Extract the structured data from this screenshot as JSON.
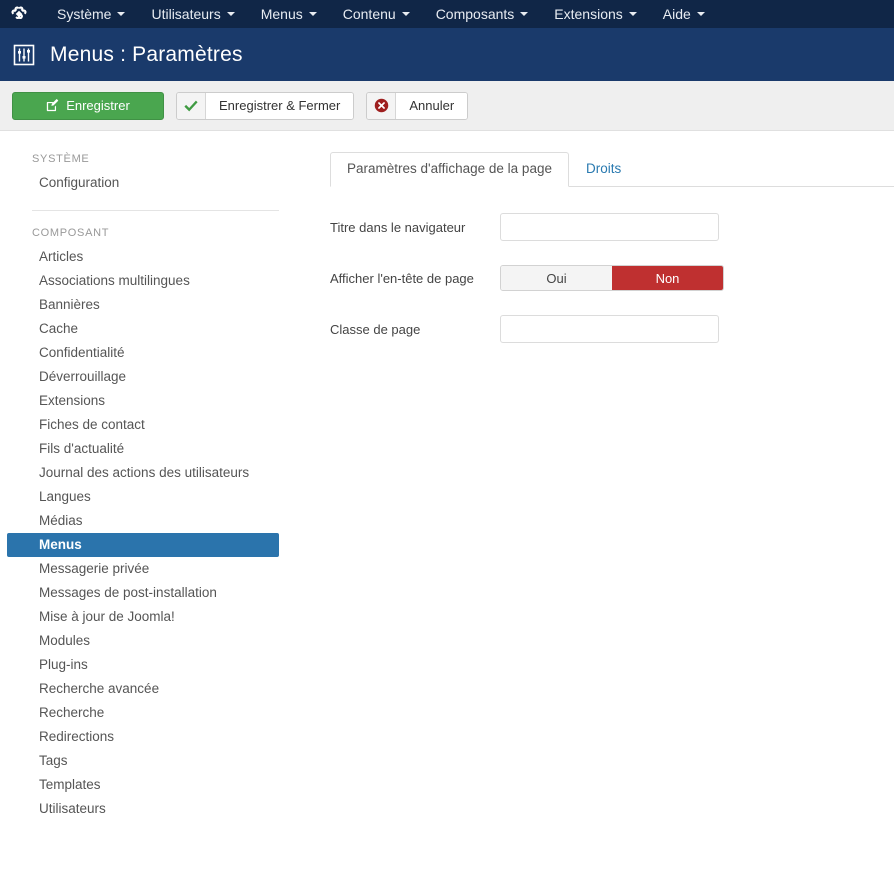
{
  "topbar": {
    "logo_icon": "joomla-logo-icon",
    "menu": [
      {
        "label": "Système",
        "caret": true
      },
      {
        "label": "Utilisateurs",
        "caret": true
      },
      {
        "label": "Menus",
        "caret": true
      },
      {
        "label": "Contenu",
        "caret": true
      },
      {
        "label": "Composants",
        "caret": true
      },
      {
        "label": "Extensions",
        "caret": true
      },
      {
        "label": "Aide",
        "caret": true
      }
    ]
  },
  "pageheader": {
    "icon": "menus-sliders-icon",
    "title": "Menus : Paramètres"
  },
  "toolbar": {
    "save_label": "Enregistrer",
    "save_icon": "edit-square-icon",
    "save_close_label": "Enregistrer & Fermer",
    "save_close_icon": "check-icon",
    "cancel_label": "Annuler",
    "cancel_icon": "cancel-circle-icon"
  },
  "sidebar": {
    "section_system_label": "SYSTÈME",
    "system_items": [
      {
        "label": "Configuration",
        "active": false
      }
    ],
    "section_component_label": "COMPOSANT",
    "component_items": [
      {
        "label": "Articles",
        "active": false
      },
      {
        "label": "Associations multilingues",
        "active": false
      },
      {
        "label": "Bannières",
        "active": false
      },
      {
        "label": "Cache",
        "active": false
      },
      {
        "label": "Confidentialité",
        "active": false
      },
      {
        "label": "Déverrouillage",
        "active": false
      },
      {
        "label": "Extensions",
        "active": false
      },
      {
        "label": "Fiches de contact",
        "active": false
      },
      {
        "label": "Fils d'actualité",
        "active": false
      },
      {
        "label": "Journal des actions des utilisateurs",
        "active": false
      },
      {
        "label": "Langues",
        "active": false
      },
      {
        "label": "Médias",
        "active": false
      },
      {
        "label": "Menus",
        "active": true
      },
      {
        "label": "Messagerie privée",
        "active": false
      },
      {
        "label": "Messages de post-installation",
        "active": false
      },
      {
        "label": "Mise à jour de Joomla!",
        "active": false
      },
      {
        "label": "Modules",
        "active": false
      },
      {
        "label": "Plug-ins",
        "active": false
      },
      {
        "label": "Recherche avancée",
        "active": false
      },
      {
        "label": "Recherche",
        "active": false
      },
      {
        "label": "Redirections",
        "active": false
      },
      {
        "label": "Tags",
        "active": false
      },
      {
        "label": "Templates",
        "active": false
      },
      {
        "label": "Utilisateurs",
        "active": false
      }
    ]
  },
  "content": {
    "tabs": [
      {
        "label": "Paramètres d'affichage de la page",
        "active": true
      },
      {
        "label": "Droits",
        "active": false
      }
    ],
    "fields": {
      "browser_title_label": "Titre dans le navigateur",
      "browser_title_value": "",
      "browser_title_placeholder": "",
      "show_page_heading_label": "Afficher l'en-tête de page",
      "show_page_heading_yes": "Oui",
      "show_page_heading_no": "Non",
      "show_page_heading_selected": "Non",
      "page_class_label": "Classe de page",
      "page_class_value": "",
      "page_class_placeholder": ""
    }
  },
  "colors": {
    "topbar_bg": "#102647",
    "header_bg": "#1a3a6b",
    "toolbar_bg": "#efefef",
    "save_green": "#4aa64f",
    "active_blue": "#2b74ac",
    "toggle_red": "#bf3030",
    "link_blue": "#2a7ab0"
  }
}
